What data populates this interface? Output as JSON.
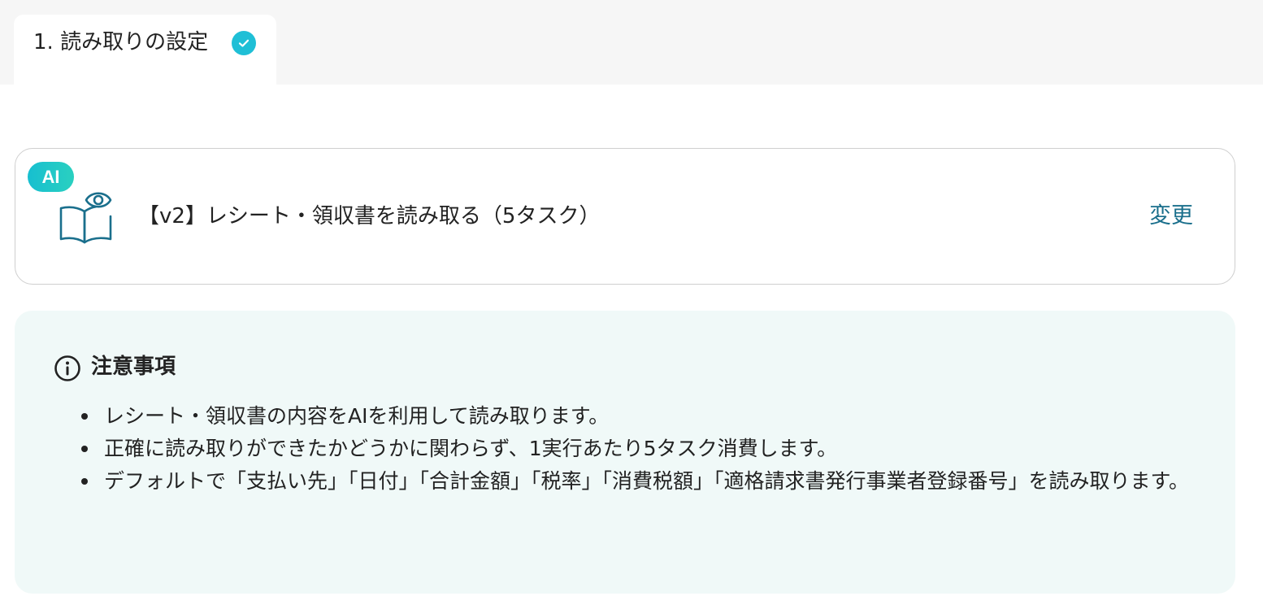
{
  "tab": {
    "label": "1. 読み取りの設定",
    "status_icon": "check-circle-icon",
    "accent": "#1fbfd6"
  },
  "app_card": {
    "badge": "AI",
    "icon": "book-eye-icon",
    "title": "【v2】レシート・領収書を読み取る（5タスク）",
    "change_label": "変更"
  },
  "notice": {
    "icon": "info-icon",
    "title": "注意事項",
    "items": [
      "レシート・領収書の内容をAIを利用して読み取ります。",
      "正確に読み取りができたかどうかに関わらず、1実行あたり5タスク消費します。",
      "デフォルトで「支払い先」「日付」「合計金額」「税率」「消費税額」「適格請求書発行事業者登録番号」を読み取ります。"
    ]
  },
  "colors": {
    "link": "#1a6f8c",
    "notice_bg": "#f0f9f8",
    "badge_gradient": [
      "#17bfd0",
      "#2ad0c0"
    ]
  }
}
